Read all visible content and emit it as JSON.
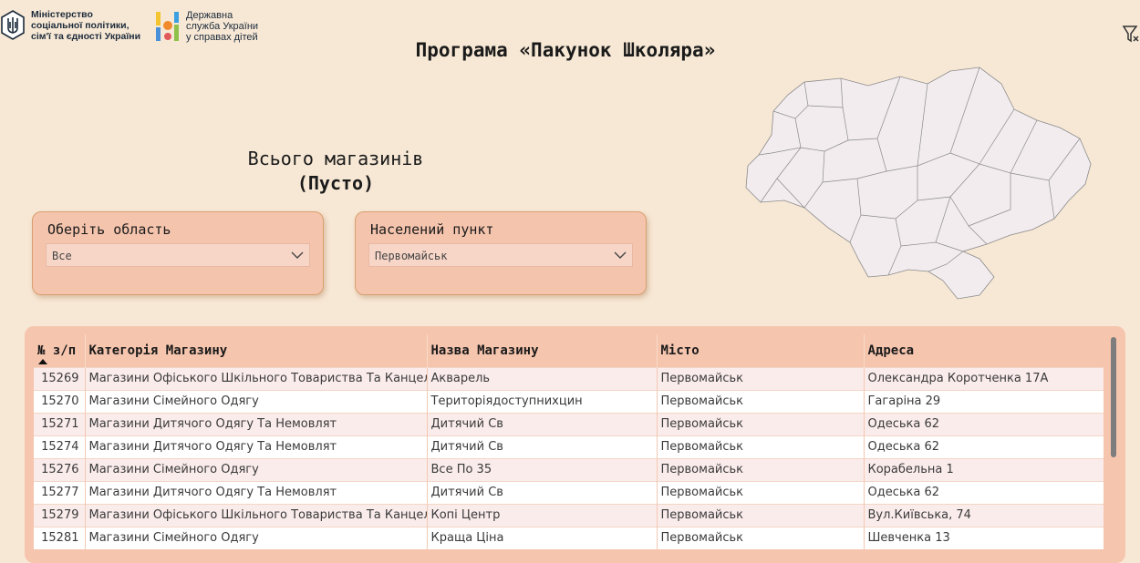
{
  "logos": {
    "ministry": "Міністерство\nсоціальної політики,\nсім'ї та єдності України",
    "service": "Державна\nслужба України\nу справах дітей"
  },
  "header": {
    "title": "Програма «Пакунок Школяра»"
  },
  "kpi": {
    "label": "Всього магазинів",
    "value": "(Пусто)"
  },
  "filters": {
    "region": {
      "label": "Оберіть область",
      "value": "Все"
    },
    "city": {
      "label": "Населений пункт",
      "value": "Первомайськ"
    }
  },
  "table": {
    "columns": [
      "№ з/п",
      "Категорія Магазину",
      "Назва Магазину",
      "Місто",
      "Адреса"
    ],
    "rows": [
      [
        "15269",
        "Магазини Офіського Шкільного Товариства Та Канцелярії",
        "Акварель",
        "Первомайськ",
        "Олександра Коротченка 17А"
      ],
      [
        "15270",
        "Магазини Сімейного Одягу",
        "Територіядоступнихцин",
        "Первомайськ",
        "Гагаріна 29"
      ],
      [
        "15271",
        "Магазини Дитячого Одягу Та Немовлят",
        "Дитячий Св",
        "Первомайськ",
        "Одеська 62"
      ],
      [
        "15274",
        "Магазини Дитячого Одягу Та Немовлят",
        "Дитячий Св",
        "Первомайськ",
        "Одеська 62"
      ],
      [
        "15276",
        "Магазини Сімейного Одягу",
        "Все По 35",
        "Первомайськ",
        "Корабельна 1"
      ],
      [
        "15277",
        "Магазини Дитячого Одягу Та Немовлят",
        "Дитячий Св",
        "Первомайськ",
        "Одеська 62"
      ],
      [
        "15279",
        "Магазини Офіського Шкільного Товариства Та Канцелярії",
        "Копі Центр",
        "Первомайськ",
        "Вул.Київська, 74"
      ],
      [
        "15281",
        "Магазини Сімейного Одягу",
        "Краща Ціна",
        "Первомайськ",
        "Шевченка 13"
      ]
    ]
  }
}
